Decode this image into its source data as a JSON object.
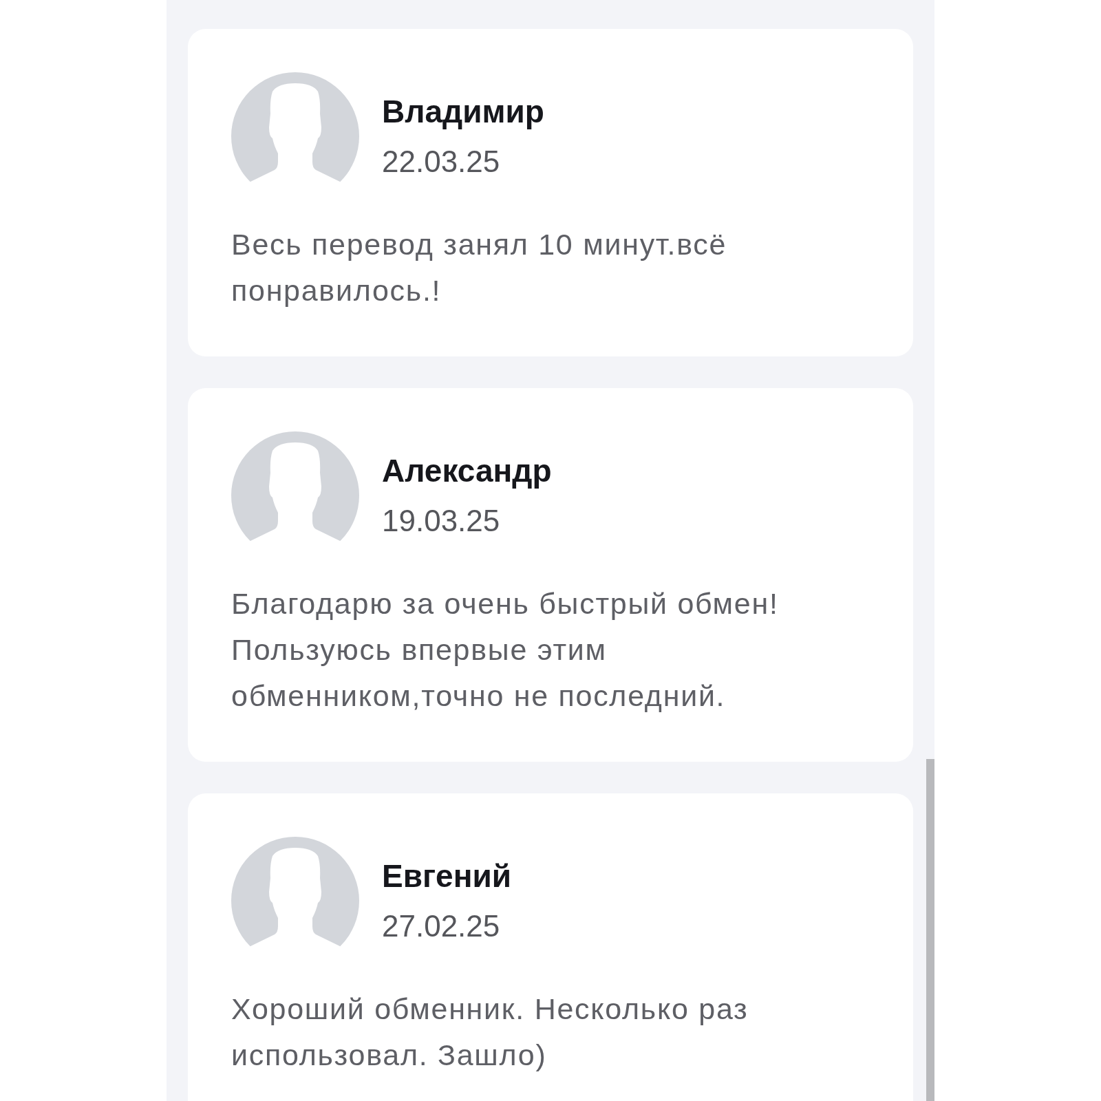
{
  "reviews": [
    {
      "name": "Владимир",
      "date": "22.03.25",
      "text": "Весь перевод занял 10 минут.всё понравилось.!"
    },
    {
      "name": "Александр",
      "date": "19.03.25",
      "text": "Благодарю за очень быстрый обмен! Пользуюсь впервые этим обменником,точно не последний."
    },
    {
      "name": "Евгений",
      "date": "27.02.25",
      "text": "Хороший обменник. Несколько раз использовал. Зашло)"
    }
  ]
}
